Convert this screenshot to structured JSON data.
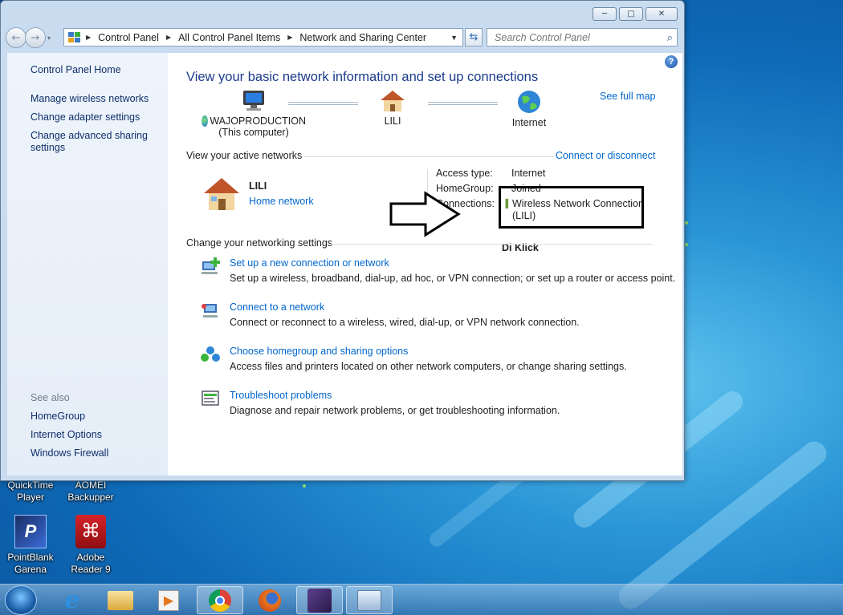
{
  "window": {
    "caption_buttons": [
      "minimize-icon",
      "maximize-icon",
      "close-icon"
    ],
    "breadcrumb": [
      "Control Panel",
      "All Control Panel Items",
      "Network and Sharing Center"
    ],
    "search_placeholder": "Search Control Panel"
  },
  "sidebar": {
    "home": "Control Panel Home",
    "links": [
      "Manage wireless networks",
      "Change adapter settings",
      "Change advanced sharing settings"
    ],
    "see_also_title": "See also",
    "see_also": [
      "HomeGroup",
      "Internet Options",
      "Windows Firewall"
    ]
  },
  "main": {
    "title": "View your basic network information and set up connections",
    "see_full_map": "See full map",
    "map": {
      "computer_name": "WAJOPRODUCTION",
      "computer_sub": "(This computer)",
      "network_name": "LILI",
      "internet_label": "Internet"
    },
    "active_networks_heading": "View your active networks",
    "connect_or_disconnect": "Connect or disconnect",
    "active_network": {
      "name": "LILI",
      "type": "Home network",
      "access_type_label": "Access type:",
      "access_type_value": "Internet",
      "homegroup_label": "HomeGroup:",
      "homegroup_value": "Joined",
      "connections_label": "Connections:",
      "connection_line1": "Wireless Network Connection",
      "connection_line2": "(LILI)"
    },
    "annotation_text": "Di Klick",
    "settings_heading": "Change your networking settings",
    "tasks": [
      {
        "title": "Set up a new connection or network",
        "desc": "Set up a wireless, broadband, dial-up, ad hoc, or VPN connection; or set up a router or access point."
      },
      {
        "title": "Connect to a network",
        "desc": "Connect or reconnect to a wireless, wired, dial-up, or VPN network connection."
      },
      {
        "title": "Choose homegroup and sharing options",
        "desc": "Access files and printers located on other network computers, or change sharing settings."
      },
      {
        "title": "Troubleshoot problems",
        "desc": "Diagnose and repair network problems, or get troubleshooting information."
      }
    ]
  },
  "desktop": {
    "icons": [
      {
        "line1": "QuickTime",
        "line2": "Player"
      },
      {
        "line1": "AOMEI",
        "line2": "Backupper"
      },
      {
        "line1": "PointBlank",
        "line2": "Garena"
      },
      {
        "line1": "Adobe",
        "line2": "Reader 9"
      }
    ]
  },
  "taskbar": {
    "items": [
      "start-orb-icon",
      "internet-explorer-icon",
      "windows-explorer-icon",
      "media-player-icon",
      "chrome-icon",
      "firefox-icon",
      "game-app-icon",
      "control-panel-icon"
    ]
  },
  "colors": {
    "link": "#0066cc",
    "title": "#1b3b8a",
    "annotation_box": "#000000"
  }
}
